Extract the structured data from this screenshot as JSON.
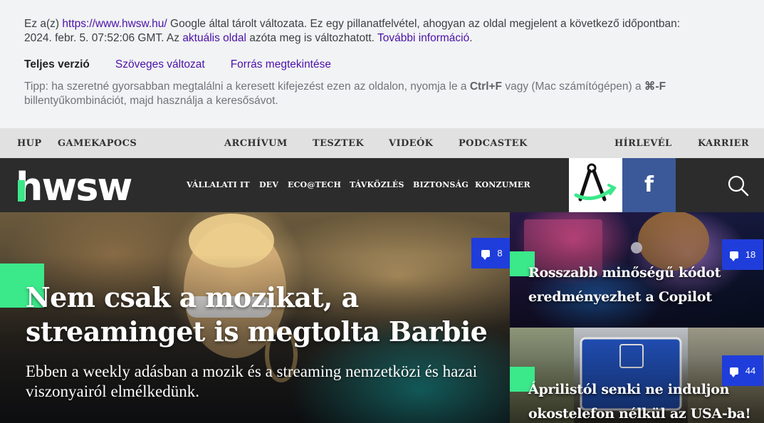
{
  "cache_banner": {
    "line1_pre": "Ez a(z) ",
    "url": "https://www.hwsw.hu/",
    "line1_post": " Google által tárolt változata. Ez egy pillanatfelvétel, ahogyan az oldal megjelent a következő időpontban:",
    "line2_pre": "2024. febr. 5. 07:52:06 GMT. Az ",
    "current_page_link": "aktuális oldal",
    "line2_mid": " azóta meg is változhatott. ",
    "more_info_link": "További információ",
    "line2_end": ".",
    "tabs": [
      "Teljes verzió",
      "Szöveges változat",
      "Forrás megtekintése"
    ],
    "tip_pre": "Tipp: ha szeretné gyorsabban megtalálni a keresett kifejezést ezen az oldalon, nyomja le a ",
    "tip_key1": "Ctrl+F",
    "tip_mid": " vagy (Mac számítógépen) a ",
    "tip_key2": "⌘-F",
    "tip_post": "billentyűkombinációt, majd használja a keresősávot."
  },
  "topnav": {
    "left": [
      "HUP",
      "GAMEKAPOCS"
    ],
    "center": [
      "ARCHÍVUM",
      "TESZTEK",
      "VIDEÓK",
      "PODCASTEK"
    ],
    "right": [
      "HÍRLEVÉL",
      "KARRIER"
    ]
  },
  "header": {
    "logo_text": "hwsw",
    "categories": [
      "VÁLLALATI IT",
      "DEV",
      "ECO@TECH",
      "TÁVKÖZLÉS",
      "BIZTONSÁG",
      "KONZUMER"
    ],
    "facebook_glyph": "f",
    "colors": {
      "logo_green": "#3be88a",
      "header_bg": "#2c2c2c",
      "facebook": "#3b5998"
    }
  },
  "hero": {
    "title": "Nem csak a mozikat, a streaminget is megtolta Barbie",
    "lead": "Ebben a weekly adásban a mozik és a streaming nemzetközi és hazai viszonyairól elmélkedünk.",
    "comments": "8"
  },
  "side_articles": [
    {
      "title": "Rosszabb minőségű kódot eredményezhet a Copilot",
      "comments": "18"
    },
    {
      "title": "Áprilistól senki ne induljon okostelefon nélkül az USA-ba!",
      "comments": "44"
    }
  ],
  "accent_color": "#3be88a",
  "badge_color": "#1f3ddb"
}
